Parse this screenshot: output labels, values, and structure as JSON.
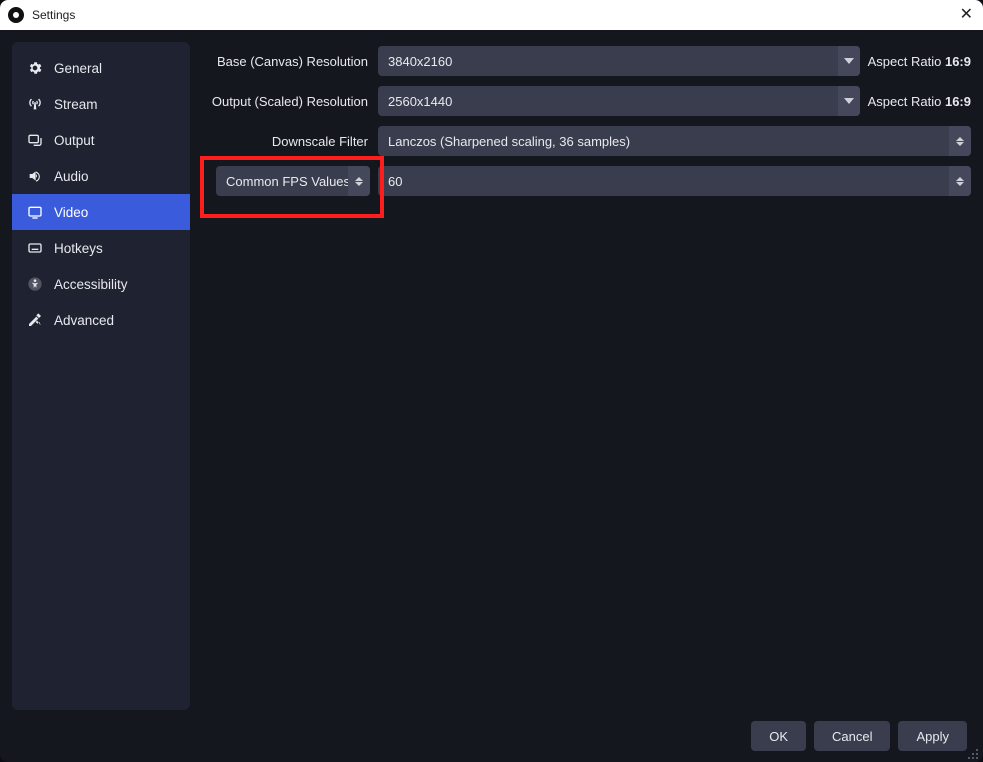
{
  "window": {
    "title": "Settings"
  },
  "sidebar": {
    "items": [
      {
        "label": "General"
      },
      {
        "label": "Stream"
      },
      {
        "label": "Output"
      },
      {
        "label": "Audio"
      },
      {
        "label": "Video"
      },
      {
        "label": "Hotkeys"
      },
      {
        "label": "Accessibility"
      },
      {
        "label": "Advanced"
      }
    ],
    "active_index": 4
  },
  "form": {
    "base_resolution": {
      "label": "Base (Canvas) Resolution",
      "value": "3840x2160",
      "aspect_prefix": "Aspect Ratio ",
      "aspect_value": "16:9"
    },
    "output_resolution": {
      "label": "Output (Scaled) Resolution",
      "value": "2560x1440",
      "aspect_prefix": "Aspect Ratio ",
      "aspect_value": "16:9"
    },
    "downscale_filter": {
      "label": "Downscale Filter",
      "value": "Lanczos (Sharpened scaling, 36 samples)"
    },
    "fps_type": {
      "value": "Common FPS Values"
    },
    "fps_value": {
      "value": "60"
    }
  },
  "footer": {
    "ok": "OK",
    "cancel": "Cancel",
    "apply": "Apply"
  }
}
